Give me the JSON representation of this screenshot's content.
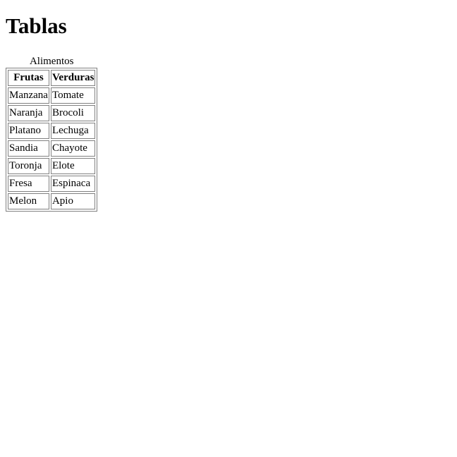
{
  "page": {
    "heading": "Tablas"
  },
  "table": {
    "caption": "Alimentos",
    "headers": [
      "Frutas",
      "Verduras"
    ],
    "rows": [
      [
        "Manzana",
        "Tomate"
      ],
      [
        "Naranja",
        "Brocoli"
      ],
      [
        "Platano",
        "Lechuga"
      ],
      [
        "Sandia",
        "Chayote"
      ],
      [
        "Toronja",
        "Elote"
      ],
      [
        "Fresa",
        "Espinaca"
      ],
      [
        "Melon",
        "Apio"
      ]
    ]
  }
}
